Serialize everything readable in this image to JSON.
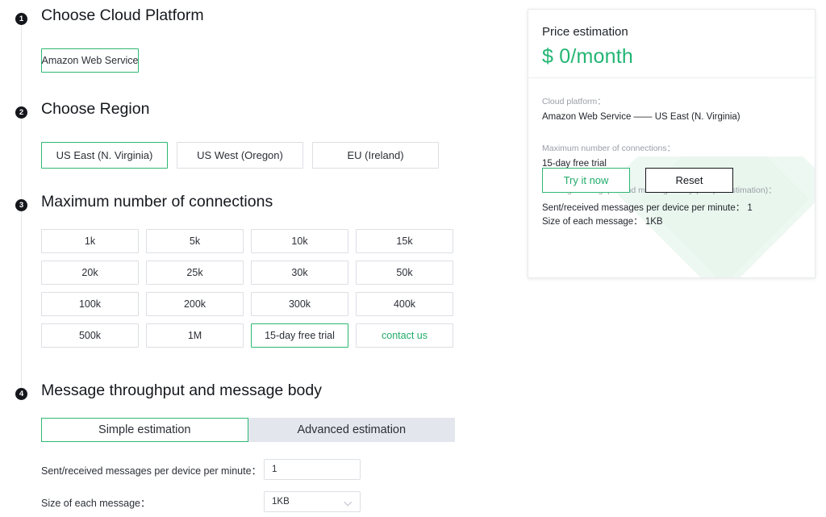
{
  "steps": [
    {
      "num": "1",
      "title": "Choose Cloud Platform"
    },
    {
      "num": "2",
      "title": "Choose Region"
    },
    {
      "num": "3",
      "title": "Maximum number of connections"
    },
    {
      "num": "4",
      "title": "Message throughput and message body"
    }
  ],
  "platforms": [
    {
      "label": "Amazon Web Service",
      "selected": true
    }
  ],
  "regions": [
    {
      "label": "US East (N. Virginia)",
      "selected": true
    },
    {
      "label": "US West (Oregon)",
      "selected": false
    },
    {
      "label": "EU (Ireland)",
      "selected": false
    }
  ],
  "connections": [
    {
      "label": "1k",
      "selected": false,
      "green_text": false
    },
    {
      "label": "5k",
      "selected": false,
      "green_text": false
    },
    {
      "label": "10k",
      "selected": false,
      "green_text": false
    },
    {
      "label": "15k",
      "selected": false,
      "green_text": false
    },
    {
      "label": "20k",
      "selected": false,
      "green_text": false
    },
    {
      "label": "25k",
      "selected": false,
      "green_text": false
    },
    {
      "label": "30k",
      "selected": false,
      "green_text": false
    },
    {
      "label": "50k",
      "selected": false,
      "green_text": false
    },
    {
      "label": "100k",
      "selected": false,
      "green_text": false
    },
    {
      "label": "200k",
      "selected": false,
      "green_text": false
    },
    {
      "label": "300k",
      "selected": false,
      "green_text": false
    },
    {
      "label": "400k",
      "selected": false,
      "green_text": false
    },
    {
      "label": "500k",
      "selected": false,
      "green_text": false
    },
    {
      "label": "1M",
      "selected": false,
      "green_text": false
    },
    {
      "label": "15-day free trial",
      "selected": true,
      "green_text": false
    },
    {
      "label": "contact us",
      "selected": false,
      "green_text": true
    }
  ],
  "estimation_tabs": [
    {
      "label": "Simple estimation",
      "active": true
    },
    {
      "label": "Advanced estimation",
      "active": false
    }
  ],
  "fields": [
    {
      "label": "Sent/received messages per device per minute：",
      "value": "1",
      "placeholder": "1",
      "type": "input",
      "name": "messages-per-minute"
    },
    {
      "label": "Size of each message：",
      "value": "1KB",
      "placeholder": "1KB",
      "type": "select",
      "name": "message-size",
      "icon": "chevron-down-icon"
    }
  ],
  "price_card": {
    "title": "Price estimation",
    "amount": "$ 0/month",
    "accent_color": "#22b573",
    "sections": [
      {
        "label": "Cloud platform：",
        "values": [
          "Amazon Web Service —— US East (N. Virginia)"
        ]
      },
      {
        "label": "Maximum number of connections：",
        "values": [
          "15-day free trial"
        ]
      },
      {
        "label": "Message throughput and message body (Simple estimation)：",
        "values": [
          "Sent/received messages per device per minute：  1",
          "Size of each message：  1KB"
        ]
      }
    ],
    "try_button": "Try it now",
    "reset_button": "Reset"
  }
}
